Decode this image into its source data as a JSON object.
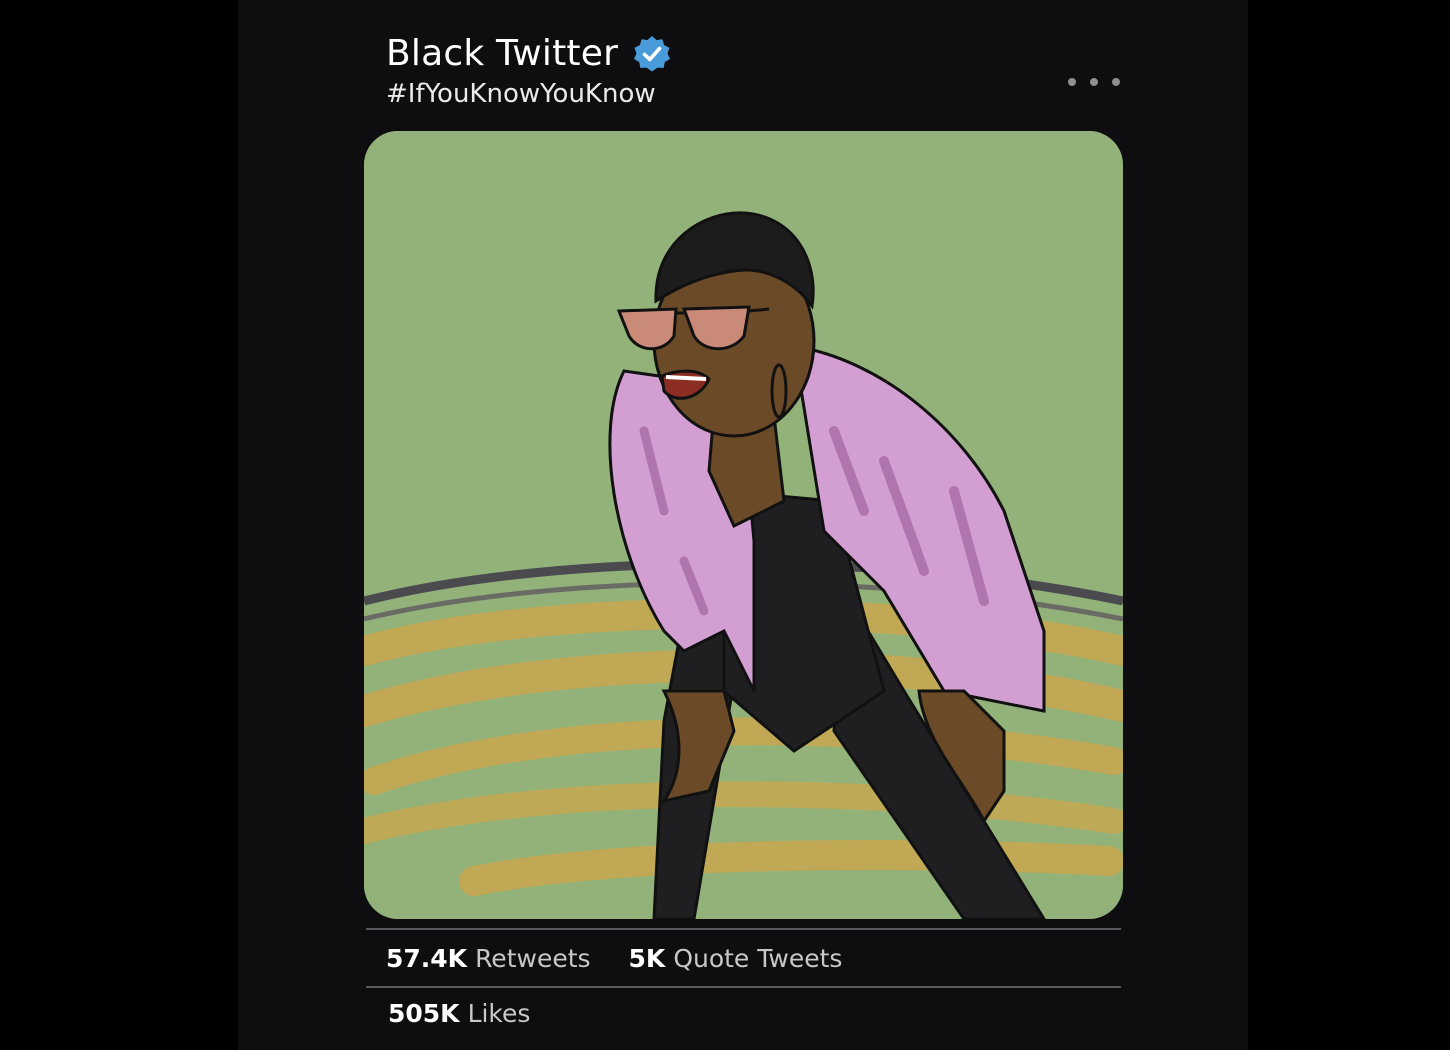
{
  "tweet": {
    "author_name": "Black Twitter",
    "verified": true,
    "handle": "#IfYouKnowYouKnow",
    "more_icon": "ellipsis-icon"
  },
  "media": {
    "background_color": "#92b27a"
  },
  "stats": {
    "retweets_value": "57.4K",
    "retweets_label": "Retweets",
    "quotes_value": "5K",
    "quotes_label": "Quote Tweets",
    "likes_value": "505K",
    "likes_label": "Likes"
  },
  "colors": {
    "verified_badge": "#4a9bd9",
    "background": "#0e0e10"
  }
}
